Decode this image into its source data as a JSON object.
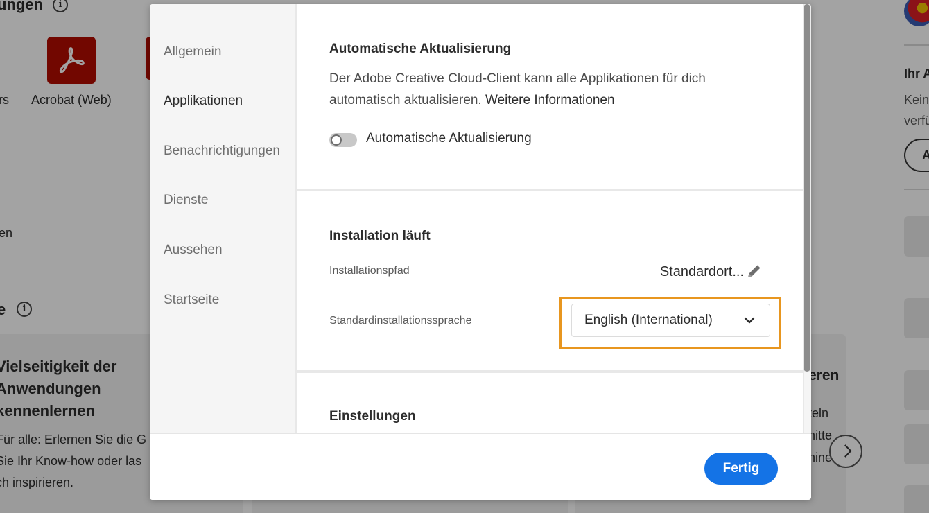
{
  "background": {
    "heading_top": "ungen",
    "heading_mid": "e",
    "acrobat_label": "Acrobat (Web)",
    "left_clip_top": "rs",
    "left_clip_mid": "en",
    "card_title_lines": [
      "Vielseitigkeit der",
      "Anwendungen",
      "kennenlernen"
    ],
    "card_body_lines": [
      "Für alle: Erlernen Sie die G",
      "Sie Ihr Know-how oder las",
      "ch inspirieren."
    ],
    "right_card_title": "eren",
    "right_card_lines": [
      "teln",
      "nitte",
      "nine"
    ],
    "right_panel_title": "Ihr A",
    "right_panel_lines": [
      "Kein",
      "verfü"
    ],
    "right_panel_button": "A",
    "info_glyph": "i"
  },
  "dialog": {
    "nav": {
      "items": [
        {
          "label": "Allgemein",
          "active": false
        },
        {
          "label": "Applikationen",
          "active": true
        },
        {
          "label": "Benachrichtigungen",
          "active": false
        },
        {
          "label": "Dienste",
          "active": false
        },
        {
          "label": "Aussehen",
          "active": false
        },
        {
          "label": "Startseite",
          "active": false
        }
      ]
    },
    "auto_update": {
      "title": "Automatische Aktualisierung",
      "description_line1": "Der Adobe Creative Cloud-Client kann alle Applikationen für dich",
      "description_line2": "automatisch aktualisieren.",
      "link": "Weitere Informationen",
      "toggle_label": "Automatische Aktualisierung",
      "toggle_on": false
    },
    "installation": {
      "title": "Installation läuft",
      "path_label": "Installationspfad",
      "path_value": "Standardort...",
      "language_label": "Standardinstallationssprache",
      "language_value": "English (International)"
    },
    "settings": {
      "title": "Einstellungen"
    },
    "footer": {
      "done_label": "Fertig"
    },
    "colors": {
      "accent": "#1473e6",
      "highlight": "#e8961f"
    }
  }
}
